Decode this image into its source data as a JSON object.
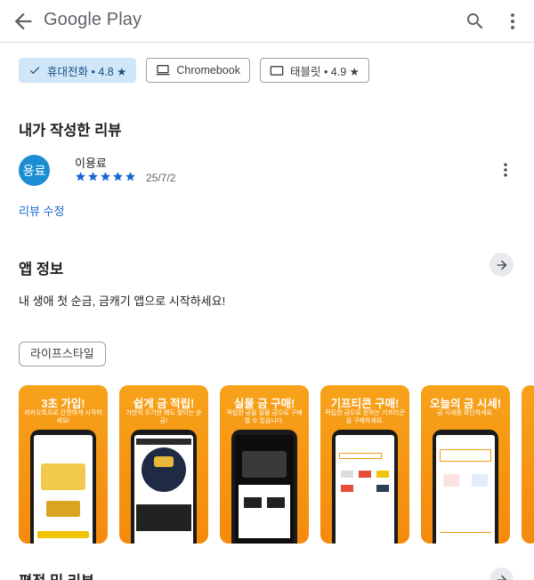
{
  "header": {
    "brand": "Google Play"
  },
  "devices": [
    {
      "label": "휴대전화 • 4.8 ★",
      "icon": "phone-icon",
      "selected": true
    },
    {
      "label": "Chromebook",
      "icon": "laptop-icon",
      "selected": false
    },
    {
      "label": "태블릿 • 4.9 ★",
      "icon": "tablet-icon",
      "selected": false
    }
  ],
  "my_review": {
    "section_title": "내가 작성한 리뷰",
    "avatar_text": "용료",
    "reviewer": "이용료",
    "rating": 5,
    "date": "25/7/2",
    "edit_label": "리뷰 수정"
  },
  "app_info": {
    "section_title": "앱 정보",
    "description": "내 생애 첫 순금, 금캐기 앱으로 시작하세요!",
    "category": "라이프스타일"
  },
  "screenshots": [
    {
      "caption": "3초 가입!",
      "sub": "카카오톡으로 간편하게 시작하세요!"
    },
    {
      "caption": "쉽게 금 적립!",
      "sub": "가만히 두기만 해도 쌓이는 순금!"
    },
    {
      "caption": "실물 금 구매!",
      "sub": "적립한 금을 실물 금으로 구매 할 수 있습니다."
    },
    {
      "caption": "기프티콘 구매!",
      "sub": "적립한 금으로 원하는 기프티콘을 구매하세요."
    },
    {
      "caption": "오늘의 금 시세!",
      "sub": "금 시세를 확인하세요."
    }
  ],
  "ratings": {
    "section_title": "평점 및 리뷰"
  },
  "colors": {
    "accent": "#1967d2",
    "selected_chip": "#d0e6f9",
    "avatar": "#1b8ed3",
    "screenshot_bg": "#f7a21b"
  }
}
